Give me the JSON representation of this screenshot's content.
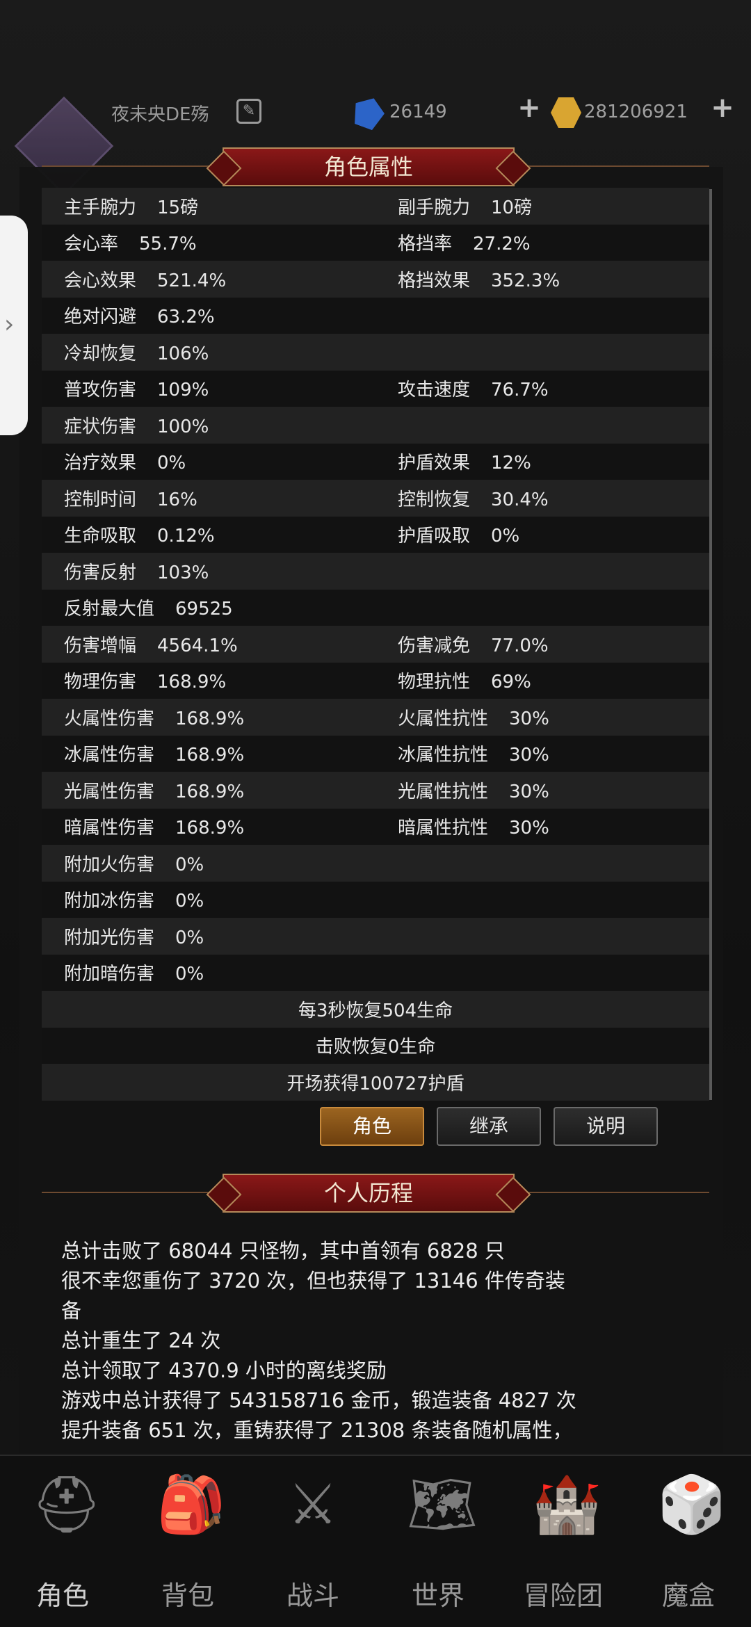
{
  "header": {
    "player_name": "夜未央DE殇",
    "gem_count": "26149",
    "gold_count": "281206921"
  },
  "panel": {
    "title": "角色属性",
    "stats": [
      {
        "l1": "主手腕力",
        "v1": "15磅",
        "l2": "副手腕力",
        "v2": "10磅"
      },
      {
        "l1": "会心率",
        "v1": "55.7%",
        "l2": "格挡率",
        "v2": "27.2%"
      },
      {
        "l1": "会心效果",
        "v1": "521.4%",
        "l2": "格挡效果",
        "v2": "352.3%"
      },
      {
        "l1": "绝对闪避",
        "v1": "63.2%",
        "l2": "",
        "v2": ""
      },
      {
        "l1": "冷却恢复",
        "v1": "106%",
        "l2": "",
        "v2": ""
      },
      {
        "l1": "普攻伤害",
        "v1": "109%",
        "l2": "攻击速度",
        "v2": "76.7%"
      },
      {
        "l1": "症状伤害",
        "v1": "100%",
        "l2": "",
        "v2": ""
      },
      {
        "l1": "治疗效果",
        "v1": "0%",
        "l2": "护盾效果",
        "v2": "12%"
      },
      {
        "l1": "控制时间",
        "v1": "16%",
        "l2": "控制恢复",
        "v2": "30.4%"
      },
      {
        "l1": "生命吸取",
        "v1": "0.12%",
        "l2": "护盾吸取",
        "v2": "0%"
      },
      {
        "l1": "伤害反射",
        "v1": "103%",
        "l2": "",
        "v2": ""
      },
      {
        "l1": "反射最大值",
        "v1": "69525",
        "l2": "",
        "v2": ""
      },
      {
        "l1": "伤害增幅",
        "v1": "4564.1%",
        "l2": "伤害减免",
        "v2": "77.0%"
      },
      {
        "l1": "物理伤害",
        "v1": "168.9%",
        "l2": "物理抗性",
        "v2": "69%"
      },
      {
        "l1": "火属性伤害",
        "v1": "168.9%",
        "l2": "火属性抗性",
        "v2": "30%"
      },
      {
        "l1": "冰属性伤害",
        "v1": "168.9%",
        "l2": "冰属性抗性",
        "v2": "30%"
      },
      {
        "l1": "光属性伤害",
        "v1": "168.9%",
        "l2": "光属性抗性",
        "v2": "30%"
      },
      {
        "l1": "暗属性伤害",
        "v1": "168.9%",
        "l2": "暗属性抗性",
        "v2": "30%"
      },
      {
        "l1": "附加火伤害",
        "v1": "0%",
        "l2": "",
        "v2": ""
      },
      {
        "l1": "附加冰伤害",
        "v1": "0%",
        "l2": "",
        "v2": ""
      },
      {
        "l1": "附加光伤害",
        "v1": "0%",
        "l2": "",
        "v2": ""
      },
      {
        "l1": "附加暗伤害",
        "v1": "0%",
        "l2": "",
        "v2": ""
      }
    ],
    "center_lines": [
      "每3秒恢复504生命",
      "击败恢复0生命",
      "开场获得100727护盾"
    ],
    "buttons": {
      "role": "角色",
      "inherit": "继承",
      "explain": "说明"
    },
    "history_title": "个人历程",
    "history_lines": [
      "总计击败了 68044 只怪物，其中首领有 6828 只",
      "很不幸您重伤了 3720 次，但也获得了 13146 件传奇装",
      "备",
      "总计重生了 24 次",
      "总计领取了 4370.9 小时的离线奖励",
      "游戏中总计获得了 543158716 金币，锻造装备 4827 次",
      "提升装备 651 次，重铸获得了 21308 条装备随机属性，"
    ]
  },
  "nav": {
    "items": [
      "角色",
      "背包",
      "战斗",
      "世界",
      "冒险团",
      "魔盒"
    ]
  }
}
